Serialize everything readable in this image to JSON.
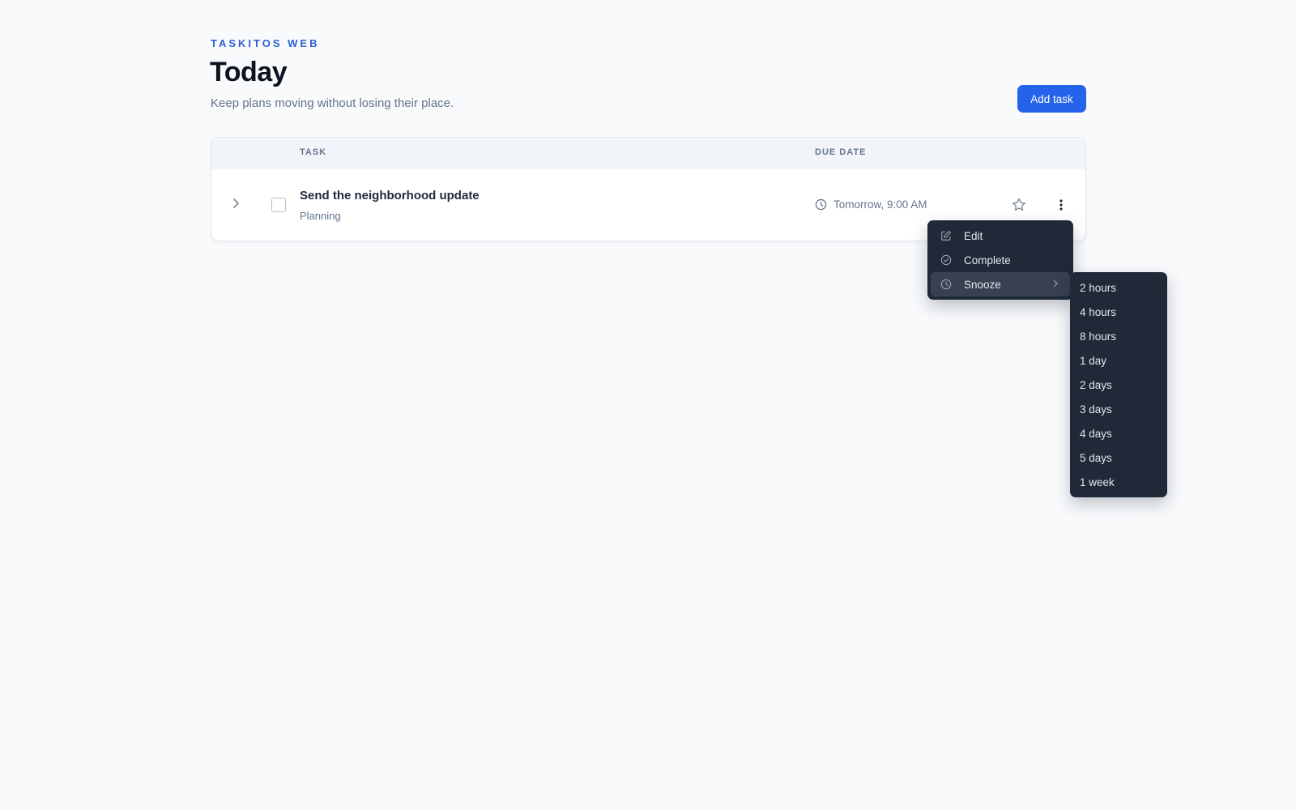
{
  "app": {
    "name": "TASKITOS WEB"
  },
  "header": {
    "title": "Today",
    "subtitle": "Keep plans moving without losing their place.",
    "add_button": "Add task"
  },
  "table": {
    "columns": {
      "task": "TASK",
      "due": "DUE DATE"
    },
    "rows": [
      {
        "title": "Send the neighborhood update",
        "tag": "Planning",
        "due": "Tomorrow, 9:00 AM",
        "completed": false,
        "starred": false
      }
    ]
  },
  "context_menu": {
    "items": [
      {
        "label": "Edit",
        "icon": "edit-icon"
      },
      {
        "label": "Complete",
        "icon": "check-circle-icon"
      },
      {
        "label": "Snooze",
        "icon": "clock-icon",
        "has_submenu": true
      }
    ],
    "snooze_options": [
      "2 hours",
      "4 hours",
      "8 hours",
      "1 day",
      "2 days",
      "3 days",
      "4 days",
      "5 days",
      "1 week"
    ]
  },
  "colors": {
    "accent": "#2563eb",
    "eyebrow": "#2f5fd0",
    "menu_bg": "#1f2937",
    "page_bg": "#f8fafc"
  }
}
